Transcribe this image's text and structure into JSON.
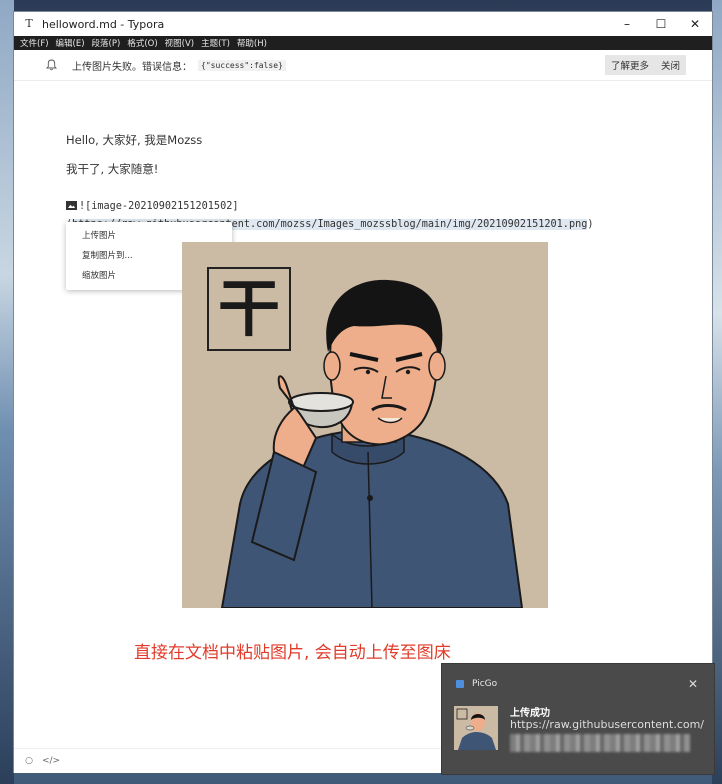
{
  "window": {
    "title": "helloword.md - Typora",
    "app_icon": "T",
    "buttons": {
      "minimize": "–",
      "maximize": "☐",
      "close": "✕"
    }
  },
  "menu": [
    "文件(F)",
    "编辑(E)",
    "段落(P)",
    "格式(O)",
    "视图(V)",
    "主题(T)",
    "帮助(H)"
  ],
  "notification": {
    "message": "上传图片失败。错误信息：",
    "code": "{\"success\":false}",
    "learn_more": "了解更多",
    "close": "关闭"
  },
  "document": {
    "line1": "Hello, 大家好, 我是Mozss",
    "line2": "我干了, 大家随意!",
    "md_prefix": "![image-20210902151201502](",
    "md_url": "https://raw.githubusercontent.com/mozss/Images_mozssblog/main/img/20210902151201.png",
    "md_suffix": ")",
    "caption": "直接在文档中粘贴图片, 会自动上传至图床"
  },
  "context_menu": {
    "items": [
      "上传图片",
      "复制图片到...",
      "缩放图片"
    ]
  },
  "image": {
    "sign_char": "干"
  },
  "toast": {
    "app": "PicGo",
    "close": "✕",
    "title": "上传成功",
    "url": "https://raw.githubusercontent.com/"
  },
  "statusbar": {
    "left_icon": "○",
    "source_icon": "</>"
  },
  "colors": {
    "caption": "#e23b2a",
    "menubar": "#1f1f1f",
    "toast_bg": "#4a4a4a",
    "highlight": "#dfe7f0"
  }
}
